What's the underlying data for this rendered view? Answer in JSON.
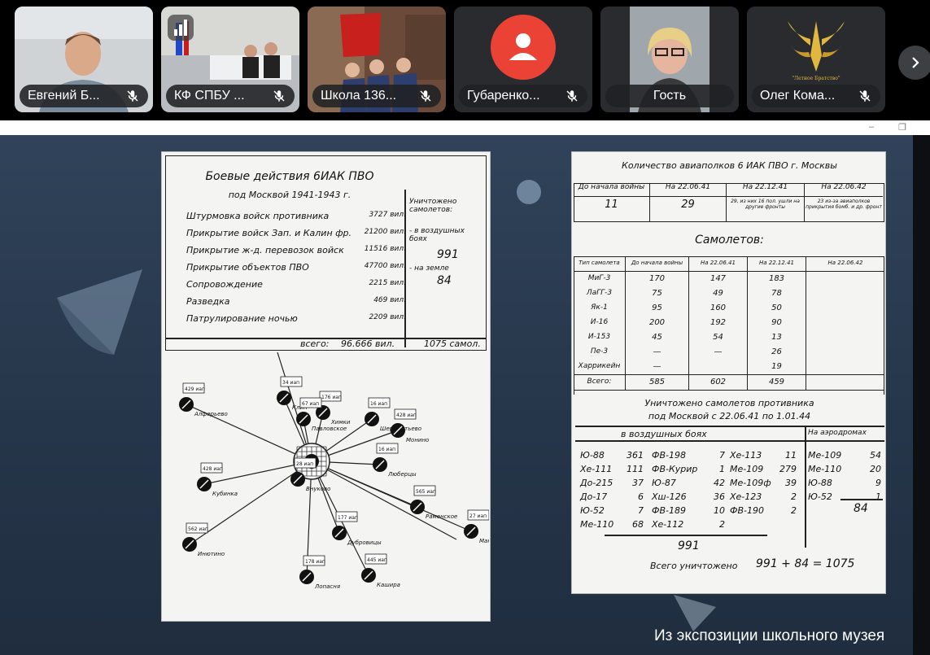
{
  "participants": [
    {
      "name": "Евгений Б...",
      "muted": true
    },
    {
      "name": "КФ СПБУ ...",
      "muted": true
    },
    {
      "name": "Школа 136...",
      "muted": true
    },
    {
      "name": "Губаренко...",
      "muted": true,
      "avatar_color": "#ea4335"
    },
    {
      "name": "Гость",
      "muted": false
    },
    {
      "name": "Олег Кома...",
      "muted": true,
      "logo_text": "\"Летное Братство\""
    }
  ],
  "caption": "Из экспозиции школьного музея",
  "doc1": {
    "title1": "Боевые действия 6ИАК ПВО",
    "title2": "под Москвой  1941-1943 г.",
    "rows": [
      {
        "label": "Штурмовка войск противника",
        "value": "3727 вил."
      },
      {
        "label": "Прикрытие войск Зап. и Калин фр.",
        "value": "21200 вил."
      },
      {
        "label": "Прикрытие ж-д. перевозок войск",
        "value": "11516 вил."
      },
      {
        "label": "Прикрытие объектов ПВО",
        "value": "47700 вил."
      },
      {
        "label": "Сопровождение",
        "value": "2215 вил."
      },
      {
        "label": "Разведка",
        "value": "469 вил."
      },
      {
        "label": "Патрулирование ночью",
        "value": "2209 вил."
      }
    ],
    "total_label": "всего:",
    "total_value": "96.666 вил.",
    "destroyed_title": "Уничтожено самолетов:",
    "air_label": "- в воздушных боях",
    "air_value": "991",
    "ground_label": "- на земле",
    "ground_value": "84",
    "destroyed_total": "1075 самол.",
    "map_nodes": [
      {
        "city": "Клин",
        "tag": "34 иап"
      },
      {
        "city": "Алферьево",
        "tag": "429 иап"
      },
      {
        "city": "Химки",
        "tag": "176 иап"
      },
      {
        "city": "Павловское",
        "tag": "67 иап"
      },
      {
        "city": "Шереметьево",
        "tag": "16 иап"
      },
      {
        "city": "Монино",
        "tag": "428 иап"
      },
      {
        "city": "Кубинка",
        "tag": "428 иап"
      },
      {
        "city": "Люберцы",
        "tag": "16 иап"
      },
      {
        "city": "Раменское",
        "tag": "565 иап"
      },
      {
        "city": "Внуково",
        "tag": "28 иап"
      },
      {
        "city": "Инютино",
        "tag": "562 иап"
      },
      {
        "city": "Кашира",
        "tag": "445 иап"
      },
      {
        "city": "Лопасня",
        "tag": "178 иап"
      },
      {
        "city": "Дубровицы",
        "tag": "177 иап"
      },
      {
        "city": "Манино",
        "tag": "27 иап"
      }
    ]
  },
  "doc2": {
    "title": "Количество авиаполков 6 ИАК ПВО г. Москвы",
    "regiment_headers": [
      "До начала войны",
      "На 22.06.41",
      "На 22.12.41",
      "На 22.06.42"
    ],
    "regiment_values": [
      "11",
      "29",
      "29, из них 16 пол. ушли на другие фронты",
      "23 из-за авиаполков прикрытия бомб. и др. фронт"
    ],
    "planes_title": "Самолетов:",
    "plane_headers": [
      "Тип самолета",
      "До начала войны",
      "На 22.06.41",
      "На 22.12.41",
      "На 22.06.42"
    ],
    "plane_rows": [
      [
        "МиГ-3",
        "170",
        "147",
        "183",
        ""
      ],
      [
        "ЛаГГ-3",
        "75",
        "49",
        "78",
        ""
      ],
      [
        "Як-1",
        "95",
        "160",
        "50",
        ""
      ],
      [
        "И-16",
        "200",
        "192",
        "90",
        ""
      ],
      [
        "И-153",
        "45",
        "54",
        "13",
        ""
      ],
      [
        "Пе-3",
        "—",
        "—",
        "26",
        ""
      ],
      [
        "Харрикейн",
        "—",
        "",
        "19",
        ""
      ],
      [
        "Всего:",
        "585",
        "602",
        "459",
        ""
      ]
    ],
    "destroyed_title": "Уничтожено самолетов противника",
    "destroyed_sub": "под Москвой  с 22.06.41 по 1.01.44",
    "air_header": "в воздушных боях",
    "ground_header": "На аэродромах",
    "air_col1": [
      [
        "Ю-88",
        "361"
      ],
      [
        "Хе-111",
        "111"
      ],
      [
        "До-215",
        "37"
      ],
      [
        "До-17",
        "6"
      ],
      [
        "Ю-52",
        "7"
      ],
      [
        "Ме-110",
        "68"
      ]
    ],
    "air_col2": [
      [
        "ФВ-198",
        "7"
      ],
      [
        "ФВ-Курир",
        "1"
      ],
      [
        "Ю-87",
        "42"
      ],
      [
        "Хш-126",
        "36"
      ],
      [
        "ФВ-189",
        "10"
      ],
      [
        "Хе-112",
        "2"
      ]
    ],
    "air_col3": [
      [
        "Хе-113",
        "11"
      ],
      [
        "Ме-109",
        "279"
      ],
      [
        "Ме-109ф",
        "39"
      ],
      [
        "Хе-123",
        "2"
      ],
      [
        "ФВ-190",
        "2"
      ]
    ],
    "ground_col": [
      [
        "Ме-109",
        "54"
      ],
      [
        "Ме-110",
        "20"
      ],
      [
        "Ю-88",
        "9"
      ],
      [
        "Ю-52",
        "1"
      ]
    ],
    "air_total": "991",
    "ground_total": "84",
    "grand_label": "Всего уничтожено",
    "grand_value": "991 + 84 = 1075"
  }
}
